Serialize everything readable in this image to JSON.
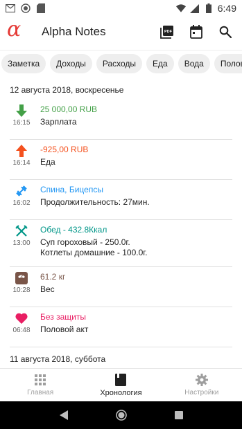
{
  "status_bar": {
    "time": "6:49"
  },
  "app_bar": {
    "logo": "α",
    "title": "Alpha Notes",
    "actions": [
      "pdf-icon",
      "calendar-icon",
      "search-icon"
    ]
  },
  "chips": [
    "Заметка",
    "Доходы",
    "Расходы",
    "Еда",
    "Вода",
    "Половой акт"
  ],
  "timeline": {
    "day1": {
      "header": "12 августа 2018, воскресенье",
      "entries": [
        {
          "icon": "arrow-down-icon",
          "time": "16:15",
          "title": "25 000,00 RUB",
          "detail": "Зарплата",
          "color": "#43a047"
        },
        {
          "icon": "arrow-up-icon",
          "time": "16:14",
          "title": "-925,00 RUB",
          "detail": "Еда",
          "color": "#f4511e"
        },
        {
          "icon": "dumbbell-icon",
          "time": "16:02",
          "title": "Спина, Бицепсы",
          "detail": "Продолжительность: 27мин.",
          "color": "#2196f3"
        },
        {
          "icon": "fork-knife-icon",
          "time": "13:00",
          "title": "Обед - 432.8Ккал",
          "detail_lines": [
            "Суп гороховый - 250.0г.",
            "Котлеты домашние - 100.0г."
          ],
          "color": "#009688"
        },
        {
          "icon": "scale-icon",
          "time": "10:28",
          "title": "61.2 кг",
          "detail": "Вес",
          "color": "#795548"
        },
        {
          "icon": "heart-icon",
          "time": "06:48",
          "title": "Без защиты",
          "detail": "Половой акт",
          "color": "#e91e63"
        }
      ]
    },
    "day2": {
      "header": "11 августа 2018, суббота"
    }
  },
  "bottom_nav": {
    "items": [
      {
        "label": "Главная",
        "icon": "grid-icon"
      },
      {
        "label": "Хронология",
        "icon": "book-icon"
      },
      {
        "label": "Настройки",
        "icon": "gear-icon"
      }
    ],
    "active": "Хронология"
  }
}
